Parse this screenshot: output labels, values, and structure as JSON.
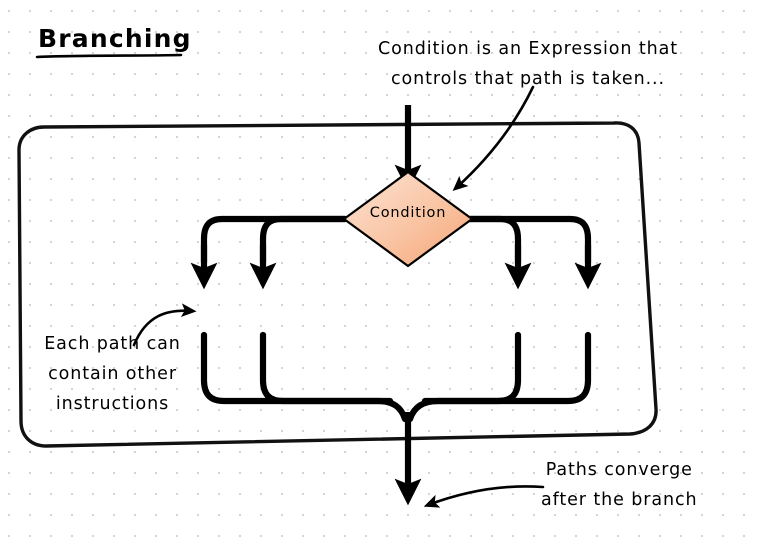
{
  "title": "Branching",
  "background": {
    "color": "#ffffff",
    "grid_dot_color": "#c9c9c9",
    "grid_spacing_px": 21
  },
  "diagram": {
    "type": "flowchart",
    "style": "hand-drawn-sketch",
    "container_label": "branch-block-outline",
    "decision": {
      "label": "Condition",
      "shape": "diamond",
      "fill_start": "#fde4d6",
      "fill_end": "#f4a373",
      "stroke": "#000000"
    },
    "branch_count": 4,
    "stroke_color": "#000000",
    "entry_arrow": "top-incoming-arrow",
    "exit_arrow": "bottom-outgoing-arrow"
  },
  "annotations": {
    "top": {
      "name": "condition-annotation",
      "lines": [
        "Condition is an Expression that",
        "controls that path is taken..."
      ],
      "line1": "Condition is an Expression that",
      "line2": "controls that path is taken..."
    },
    "left": {
      "name": "path-contents-annotation",
      "lines": [
        "Each path can",
        "contain other",
        "instructions"
      ],
      "line1": "Each path can",
      "line2": "contain other",
      "line3": "instructions"
    },
    "bottom": {
      "name": "converge-annotation",
      "lines": [
        "Paths converge",
        "after the branch"
      ],
      "line1": "Paths converge",
      "line2": "after the branch"
    }
  }
}
